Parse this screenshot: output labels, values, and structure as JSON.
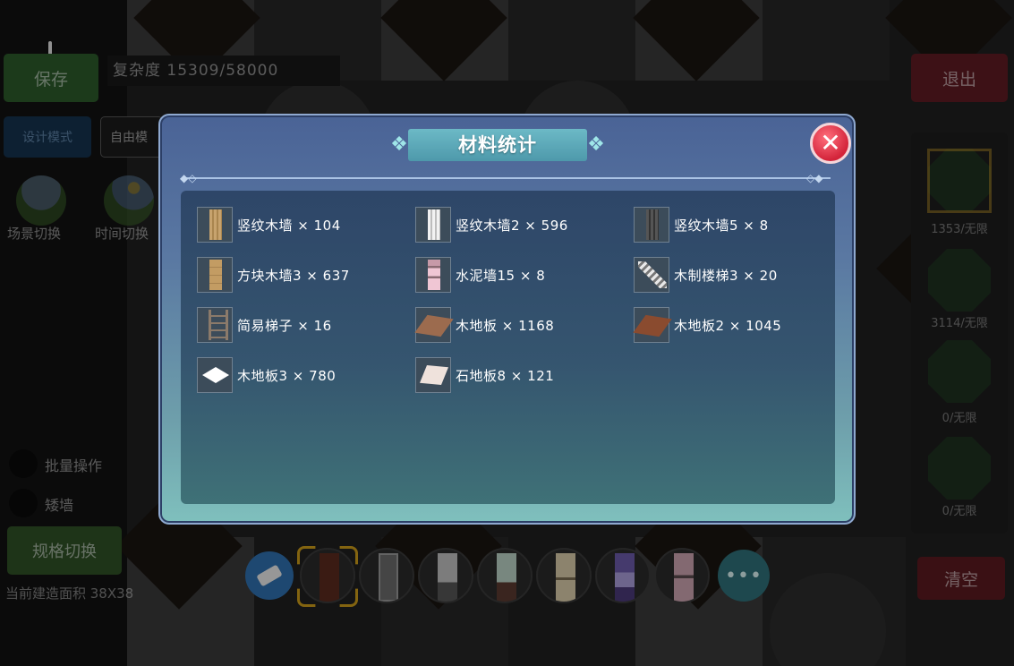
{
  "hud": {
    "save": "保存",
    "complexity": "复杂度 15309/58000",
    "design_mode": "设计模式",
    "free_mode": "自由模",
    "scene_switch": "场景切换",
    "time_switch": "时间切换",
    "batch_op": "批量操作",
    "low_wall": "矮墙",
    "spec_switch": "规格切换",
    "build_area": "当前建造面积 38X38",
    "exit": "退出",
    "clear": "清空",
    "more": "•••"
  },
  "right_panel": {
    "counts": [
      "1353/无限",
      "3114/无限",
      "0/无限",
      "0/无限"
    ]
  },
  "dialog": {
    "title": "材料统计",
    "close_icon": "✕",
    "items": [
      {
        "name": "竖纹木墙 × 104",
        "icon": "plank"
      },
      {
        "name": "竖纹木墙2 × 596",
        "icon": "white"
      },
      {
        "name": "竖纹木墙5 × 8",
        "icon": "dark"
      },
      {
        "name": "方块木墙3 × 637",
        "icon": "block"
      },
      {
        "name": "水泥墙15 × 8",
        "icon": "pink"
      },
      {
        "name": "木制楼梯3 × 20",
        "icon": "stairs"
      },
      {
        "name": "简易梯子 × 16",
        "icon": "ladder"
      },
      {
        "name": "木地板 × 1168",
        "icon": "floor"
      },
      {
        "name": "木地板2 × 1045",
        "icon": "floor2"
      },
      {
        "name": "木地板3 × 780",
        "icon": "floor3"
      },
      {
        "name": "石地板8 × 121",
        "icon": "stone"
      }
    ]
  },
  "colors": {
    "dialog_top": "#4a6396",
    "dialog_bottom": "#7fc0bd",
    "title_plate": "#5aa8b9",
    "close_button": "#d3243a"
  }
}
